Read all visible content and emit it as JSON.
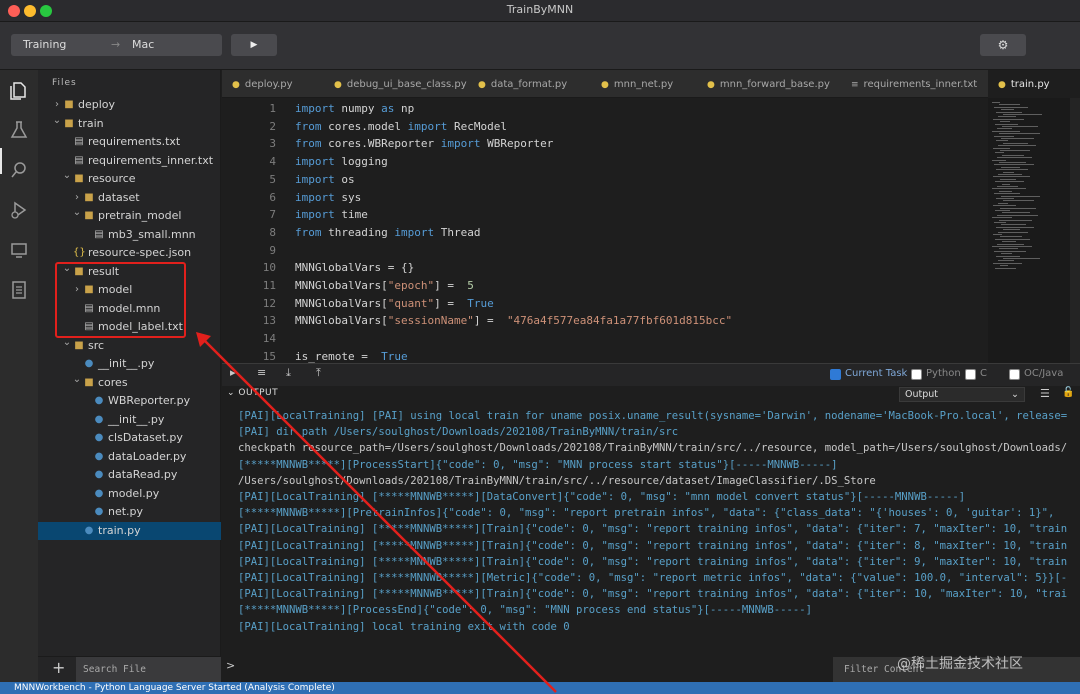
{
  "window": {
    "title": "TrainByMNN"
  },
  "toolbar": {
    "target": "Training",
    "arrow": "→",
    "platform": "Mac",
    "run_icon": "▶",
    "settings_icon": "⚙"
  },
  "sidebar": {
    "header": "Files",
    "tree": [
      {
        "name": "deploy",
        "type": "folder",
        "depth": 0,
        "expanded": false
      },
      {
        "name": "train",
        "type": "folder",
        "depth": 0,
        "expanded": true
      },
      {
        "name": "requirements.txt",
        "type": "text",
        "depth": 1
      },
      {
        "name": "requirements_inner.txt",
        "type": "text",
        "depth": 1
      },
      {
        "name": "resource",
        "type": "folder",
        "depth": 1,
        "expanded": true
      },
      {
        "name": "dataset",
        "type": "folder",
        "depth": 2,
        "expanded": false
      },
      {
        "name": "pretrain_model",
        "type": "folder",
        "depth": 2,
        "expanded": true
      },
      {
        "name": "mb3_small.mnn",
        "type": "text",
        "depth": 3
      },
      {
        "name": "resource-spec.json",
        "type": "json",
        "depth": 1
      },
      {
        "name": "result",
        "type": "folder",
        "depth": 1,
        "expanded": true
      },
      {
        "name": "model",
        "type": "folder",
        "depth": 2,
        "expanded": false
      },
      {
        "name": "model.mnn",
        "type": "text",
        "depth": 2
      },
      {
        "name": "model_label.txt",
        "type": "text",
        "depth": 2
      },
      {
        "name": "src",
        "type": "folder",
        "depth": 1,
        "expanded": true
      },
      {
        "name": "__init__.py",
        "type": "python",
        "depth": 2
      },
      {
        "name": "cores",
        "type": "folder",
        "depth": 2,
        "expanded": true
      },
      {
        "name": "WBReporter.py",
        "type": "python",
        "depth": 3
      },
      {
        "name": "__init__.py",
        "type": "python",
        "depth": 3
      },
      {
        "name": "clsDataset.py",
        "type": "python",
        "depth": 3
      },
      {
        "name": "dataLoader.py",
        "type": "python",
        "depth": 3
      },
      {
        "name": "dataRead.py",
        "type": "python",
        "depth": 3
      },
      {
        "name": "model.py",
        "type": "python",
        "depth": 3
      },
      {
        "name": "net.py",
        "type": "python",
        "depth": 3
      },
      {
        "name": "train.py",
        "type": "python",
        "depth": 2,
        "selected": true
      }
    ],
    "add_icon": "+",
    "search_placeholder": "Search File"
  },
  "tabs": [
    {
      "label": "deploy.py",
      "icon": "python",
      "active": false
    },
    {
      "label": "debug_ui_base_class.py",
      "icon": "python",
      "active": false
    },
    {
      "label": "data_format.py",
      "icon": "python",
      "active": false
    },
    {
      "label": "mnn_net.py",
      "icon": "python",
      "active": false
    },
    {
      "label": "mnn_forward_base.py",
      "icon": "python",
      "active": false
    },
    {
      "label": "requirements_inner.txt",
      "icon": "text",
      "active": false
    },
    {
      "label": "train.py",
      "icon": "python",
      "active": true
    }
  ],
  "editor": {
    "lines": [
      {
        "n": "1",
        "t": [
          [
            "kw",
            "import"
          ],
          [
            "",
            "numpy"
          ],
          [
            "kw",
            "as"
          ],
          [
            "",
            "np"
          ]
        ]
      },
      {
        "n": "2",
        "t": [
          [
            "kw",
            "from"
          ],
          [
            "",
            "cores.model"
          ],
          [
            "kw",
            "import"
          ],
          [
            "",
            "RecModel"
          ]
        ]
      },
      {
        "n": "3",
        "t": [
          [
            "kw",
            "from"
          ],
          [
            "",
            "cores.WBReporter"
          ],
          [
            "kw",
            "import"
          ],
          [
            "",
            "WBReporter"
          ]
        ]
      },
      {
        "n": "4",
        "t": [
          [
            "kw",
            "import"
          ],
          [
            "",
            "logging"
          ]
        ]
      },
      {
        "n": "5",
        "t": [
          [
            "kw",
            "import"
          ],
          [
            "",
            "os"
          ]
        ]
      },
      {
        "n": "6",
        "t": [
          [
            "kw",
            "import"
          ],
          [
            "",
            "sys"
          ]
        ]
      },
      {
        "n": "7",
        "t": [
          [
            "kw",
            "import"
          ],
          [
            "",
            "time"
          ]
        ]
      },
      {
        "n": "8",
        "t": [
          [
            "kw",
            "from"
          ],
          [
            "",
            "threading"
          ],
          [
            "kw",
            "import"
          ],
          [
            "",
            "Thread"
          ]
        ]
      },
      {
        "n": "9",
        "t": []
      },
      {
        "n": "10",
        "t": [
          [
            "",
            "MNNGlobalVars = {}"
          ]
        ]
      },
      {
        "n": "11",
        "t": [
          [
            "",
            "MNNGlobalVars["
          ],
          [
            "str",
            "\"epoch\""
          ],
          [
            "",
            "] = "
          ],
          [
            "num",
            "5"
          ]
        ]
      },
      {
        "n": "12",
        "t": [
          [
            "",
            "MNNGlobalVars["
          ],
          [
            "str",
            "\"quant\""
          ],
          [
            "",
            "] = "
          ],
          [
            "kw",
            "True"
          ]
        ]
      },
      {
        "n": "13",
        "t": [
          [
            "",
            "MNNGlobalVars["
          ],
          [
            "str",
            "\"sessionName\""
          ],
          [
            "",
            "] = "
          ],
          [
            "str",
            "\"476a4f577ea84fa1a77fbf601d815bcc\""
          ]
        ]
      },
      {
        "n": "14",
        "t": []
      },
      {
        "n": "15",
        "t": [
          [
            "",
            "is_remote = "
          ],
          [
            "kw",
            "True"
          ]
        ]
      }
    ]
  },
  "panel": {
    "icons": {
      "play": "▸",
      "list": "≡",
      "download": "⤓",
      "upload": "⤒",
      "clear": "☰",
      "lock": "🔓"
    },
    "filters": [
      {
        "label": "Current Task",
        "checked": true
      },
      {
        "label": "Python",
        "checked": false
      },
      {
        "label": "C",
        "checked": false
      },
      {
        "label": "OC/Java",
        "checked": false
      }
    ],
    "header": "OUTPUT",
    "output_select": "Output",
    "select_chevron": "⌄",
    "log": [
      {
        "text": "[PAI][LocalTraining] [PAI] using local train for uname posix.uname_result(sysname='Darwin', nodename='MacBook-Pro.local', release=",
        "plain": false
      },
      {
        "text": "[PAI] dir path /Users/soulghost/Downloads/202108/TrainByMNN/train/src",
        "plain": false
      },
      {
        "text": "checkpath resource_path=/Users/soulghost/Downloads/202108/TrainByMNN/train/src/../resource, model_path=/Users/soulghost/Downloads/",
        "plain": true
      },
      {
        "text": "[*****MNNWB*****][ProcessStart]{\"code\": 0, \"msg\": \"MNN process start status\"}[-----MNNWB-----]",
        "plain": false
      },
      {
        "text": "/Users/soulghost/Downloads/202108/TrainByMNN/train/src/../resource/dataset/ImageClassifier/.DS_Store",
        "plain": true
      },
      {
        "text": "[PAI][LocalTraining] [*****MNNWB*****][DataConvert]{\"code\": 0, \"msg\": \"mnn model convert status\"}[-----MNNWB-----]",
        "plain": false
      },
      {
        "text": "[*****MNNWB*****][PretrainInfos]{\"code\": 0, \"msg\": \"report pretrain infos\", \"data\": {\"class_data\": \"{'houses': 0, 'guitar': 1}\", ",
        "plain": false
      },
      {
        "text": "[PAI][LocalTraining] [*****MNNWB*****][Train]{\"code\": 0, \"msg\": \"report training infos\", \"data\": {\"iter\": 7, \"maxIter\": 10, \"train",
        "plain": false
      },
      {
        "text": "[PAI][LocalTraining] [*****MNNWB*****][Train]{\"code\": 0, \"msg\": \"report training infos\", \"data\": {\"iter\": 8, \"maxIter\": 10, \"train",
        "plain": false
      },
      {
        "text": "[PAI][LocalTraining] [*****MNNWB*****][Train]{\"code\": 0, \"msg\": \"report training infos\", \"data\": {\"iter\": 9, \"maxIter\": 10, \"train",
        "plain": false
      },
      {
        "text": "[PAI][LocalTraining] [*****MNNWB*****][Metric]{\"code\": 0, \"msg\": \"report metric infos\", \"data\": {\"value\": 100.0, \"interval\": 5}}[-",
        "plain": false
      },
      {
        "text": "[PAI][LocalTraining] [*****MNNWB*****][Train]{\"code\": 0, \"msg\": \"report training infos\", \"data\": {\"iter\": 10, \"maxIter\": 10, \"trai",
        "plain": false
      },
      {
        "text": "[*****MNNWB*****][ProcessEnd]{\"code\": 0, \"msg\": \"MNN process end status\"}[-----MNNWB-----]",
        "plain": false
      },
      {
        "text": "[PAI][LocalTraining] local training exit with code 0",
        "plain": false
      }
    ],
    "prompt": ">",
    "filter_placeholder": "Filter Content"
  },
  "watermark": "@稀土掘金技术社区",
  "status": {
    "text": "MNNWorkbench - Python Language Server Started (Analysis Complete)"
  },
  "colors": {
    "accent": "#2f6fb4",
    "highlight": "#e2201c",
    "selection": "#094771"
  }
}
